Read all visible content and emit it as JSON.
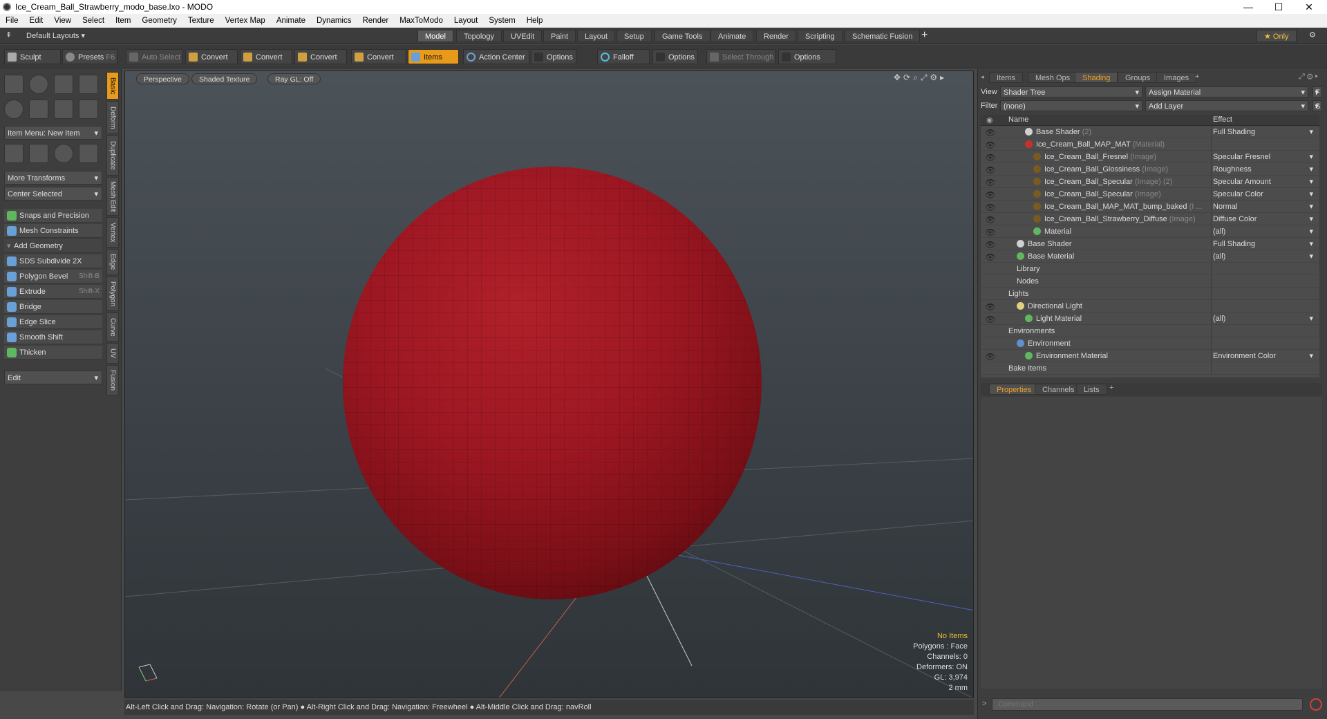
{
  "window": {
    "title": "Ice_Cream_Ball_Strawberry_modo_base.lxo - MODO",
    "minimize": "—",
    "maximize": "☐",
    "close": "✕"
  },
  "menu": [
    "File",
    "Edit",
    "View",
    "Select",
    "Item",
    "Geometry",
    "Texture",
    "Vertex Map",
    "Animate",
    "Dynamics",
    "Render",
    "MaxToModo",
    "Layout",
    "System",
    "Help"
  ],
  "layout_bar": {
    "layout_select": "Default Layouts ▾",
    "tabs": [
      "Model",
      "Topology",
      "UVEdit",
      "Paint",
      "Layout",
      "Setup",
      "Game Tools",
      "Animate",
      "Render",
      "Scripting",
      "Schematic Fusion"
    ],
    "active_tab": "Model",
    "add": "+",
    "only": "★  Only",
    "gear": "⚙"
  },
  "toolbar": {
    "sculpt": "Sculpt",
    "presets": "Presets",
    "presets_key": "F6",
    "auto_select": "Auto Select",
    "convert1": "Convert",
    "convert2": "Convert",
    "convert3": "Convert",
    "convert4": "Convert",
    "items": "Items",
    "action_center": "Action Center",
    "options1": "Options",
    "falloff": "Falloff",
    "options2": "Options",
    "select_through": "Select Through",
    "options3": "Options"
  },
  "left_panel": {
    "item_menu": "Item Menu: New Item",
    "more_transforms": "More Transforms",
    "center_selected": "Center Selected",
    "snaps": "Snaps and Precision",
    "mesh_constraints": "Mesh Constraints",
    "add_geometry": "Add Geometry",
    "tools": [
      {
        "label": "SDS Subdivide 2X",
        "shortcut": ""
      },
      {
        "label": "Polygon Bevel",
        "shortcut": "Shift-B"
      },
      {
        "label": "Extrude",
        "shortcut": "Shift-X"
      },
      {
        "label": "Bridge",
        "shortcut": ""
      },
      {
        "label": "Edge Slice",
        "shortcut": ""
      },
      {
        "label": "Smooth Shift",
        "shortcut": ""
      },
      {
        "label": "Thicken",
        "shortcut": ""
      }
    ],
    "edit": "Edit",
    "vertical_tabs": [
      "Basic",
      "Deform",
      "Duplicate",
      "Mesh Edit",
      "Vertex",
      "Edge",
      "Polygon",
      "Curve",
      "UV",
      "Fusion"
    ]
  },
  "viewport": {
    "perspective": "Perspective",
    "shaded": "Shaded Texture",
    "raygl": "Ray GL: Off",
    "info": {
      "no_items": "No Items",
      "polygons": "Polygons : Face",
      "channels": "Channels: 0",
      "deformers": "Deformers: ON",
      "gl": "GL: 3,974",
      "scale": "2 mm"
    },
    "sphere_color": "#9c1722"
  },
  "status": "Alt-Left Click and Drag: Navigation: Rotate (or Pan) ● Alt-Right Click and Drag: Navigation: Freewheel ● Alt-Middle Click and Drag: navRoll",
  "right_panel": {
    "tabs": [
      "Items",
      "Mesh Ops",
      "Shading",
      "Groups",
      "Images"
    ],
    "active_tab": "Shading",
    "add": "+",
    "view_label": "View",
    "view_value": "Shader Tree",
    "assign_material": "Assign Material",
    "f_btn": "F",
    "filter_label": "Filter",
    "filter_value": "(none)",
    "add_layer": "Add Layer",
    "s_btn": "S",
    "col_name": "Name",
    "col_effect": "Effect",
    "rows": [
      {
        "name": "Base Shader",
        "sub": "(2)",
        "effect": "Full Shading",
        "indent": 2,
        "eye": true,
        "ball": "#d0d0d0"
      },
      {
        "name": "Ice_Cream_Ball_MAP_MAT",
        "sub": "(Material)",
        "effect": "",
        "indent": 2,
        "eye": true,
        "ball": "#c83030"
      },
      {
        "name": "Ice_Cream_Ball_Fresnel",
        "sub": "(Image)",
        "effect": "Specular Fresnel",
        "indent": 3,
        "eye": true,
        "ball": "#7a5a20"
      },
      {
        "name": "Ice_Cream_Ball_Glossiness",
        "sub": "(Image)",
        "effect": "Roughness",
        "indent": 3,
        "eye": true,
        "ball": "#7a5a20"
      },
      {
        "name": "Ice_Cream_Ball_Specular",
        "sub": "(Image) (2)",
        "effect": "Specular Amount",
        "indent": 3,
        "eye": true,
        "ball": "#7a5a20"
      },
      {
        "name": "Ice_Cream_Ball_Specular",
        "sub": "(Image)",
        "effect": "Specular Color",
        "indent": 3,
        "eye": true,
        "ball": "#7a5a20"
      },
      {
        "name": "Ice_Cream_Ball_MAP_MAT_bump_baked",
        "sub": "(I ...",
        "effect": "Normal",
        "indent": 3,
        "eye": true,
        "ball": "#7a5a20"
      },
      {
        "name": "Ice_Cream_Ball_Strawberry_Diffuse",
        "sub": "(Image)",
        "effect": "Diffuse Color",
        "indent": 3,
        "eye": true,
        "ball": "#7a5a20"
      },
      {
        "name": "Material",
        "sub": "",
        "effect": "(all)",
        "indent": 3,
        "eye": true,
        "ball": "#5fb85f"
      },
      {
        "name": "Base Shader",
        "sub": "",
        "effect": "Full Shading",
        "indent": 1,
        "eye": true,
        "ball": "#d0d0d0"
      },
      {
        "name": "Base Material",
        "sub": "",
        "effect": "(all)",
        "indent": 1,
        "eye": true,
        "ball": "#5fb85f"
      },
      {
        "name": "Library",
        "sub": "",
        "effect": "",
        "indent": 1,
        "eye": false,
        "ball": ""
      },
      {
        "name": "Nodes",
        "sub": "",
        "effect": "",
        "indent": 1,
        "eye": false,
        "ball": ""
      },
      {
        "name": "Lights",
        "sub": "",
        "effect": "",
        "indent": 0,
        "eye": false,
        "ball": ""
      },
      {
        "name": "Directional Light",
        "sub": "",
        "effect": "",
        "indent": 1,
        "eye": true,
        "ball": "#e0d080"
      },
      {
        "name": "Light Material",
        "sub": "",
        "effect": "(all)",
        "indent": 2,
        "eye": true,
        "ball": "#5fb85f"
      },
      {
        "name": "Environments",
        "sub": "",
        "effect": "",
        "indent": 0,
        "eye": false,
        "ball": ""
      },
      {
        "name": "Environment",
        "sub": "",
        "effect": "",
        "indent": 1,
        "eye": false,
        "ball": "#6090d0"
      },
      {
        "name": "Environment Material",
        "sub": "",
        "effect": "Environment Color",
        "indent": 2,
        "eye": true,
        "ball": "#5fb85f"
      },
      {
        "name": "Bake Items",
        "sub": "",
        "effect": "",
        "indent": 0,
        "eye": false,
        "ball": ""
      }
    ],
    "prop_tabs": [
      "Properties",
      "Channels",
      "Lists"
    ],
    "prop_active": "Properties",
    "command_placeholder": "Command",
    "cmd_prompt": ">"
  }
}
